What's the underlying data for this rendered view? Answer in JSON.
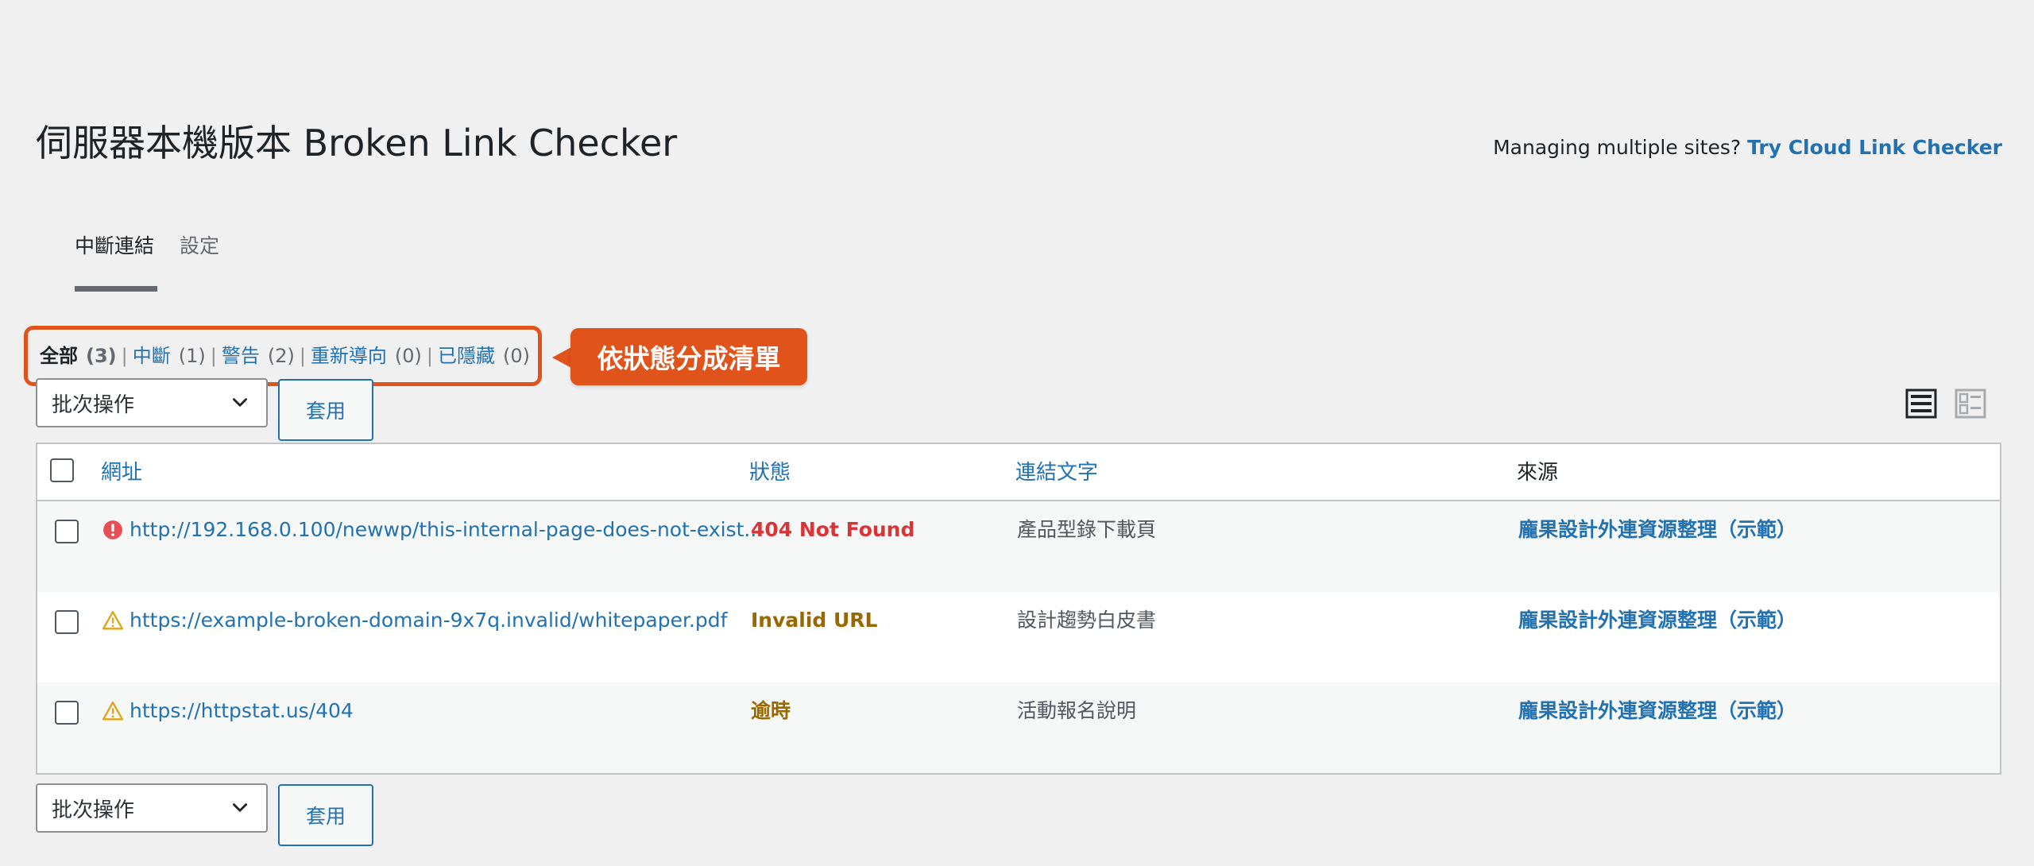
{
  "page": {
    "title": "伺服器本機版本 Broken Link Checker",
    "cloud_question": "Managing multiple sites?",
    "cloud_link": "Try Cloud Link Checker"
  },
  "tabs": {
    "broken_links": "中斷連結",
    "settings": "設定"
  },
  "filters": {
    "all": {
      "label": "全部",
      "count": "(3)"
    },
    "broken": {
      "label": "中斷",
      "count": "(1)"
    },
    "warning": {
      "label": "警告",
      "count": "(2)"
    },
    "redirect": {
      "label": "重新導向",
      "count": "(0)"
    },
    "dismissed": {
      "label": "已隱藏",
      "count": "(0)"
    },
    "separator": "|"
  },
  "callout": {
    "text": "依狀態分成清單"
  },
  "bulk": {
    "select_label": "批次操作",
    "apply_label": "套用"
  },
  "table": {
    "headers": {
      "url": "網址",
      "status": "狀態",
      "link_text": "連結文字",
      "source": "來源"
    },
    "rows": [
      {
        "url": "http://192.168.0.100/newwp/this-internal-page-does-not-exist...",
        "status": "404 Not Found",
        "link_text": "產品型錄下載頁",
        "source": "龐果設計外連資源整理（示範）",
        "icon": "error-icon"
      },
      {
        "url": "https://example-broken-domain-9x7q.invalid/whitepaper.pdf",
        "status": "Invalid URL",
        "link_text": "設計趨勢白皮書",
        "source": "龐果設計外連資源整理（示範）",
        "icon": "warning-icon"
      },
      {
        "url": "https://httpstat.us/404",
        "status": "逾時",
        "link_text": "活動報名說明",
        "source": "龐果設計外連資源整理（示範）",
        "icon": "warning-icon"
      }
    ]
  },
  "colors": {
    "accent": "#2271b1",
    "callout": "#e0531b",
    "status_error": "#d63638",
    "status_warning": "#996800",
    "icon_error": "#e65054",
    "icon_warning": "#dba617"
  },
  "icons": {
    "view_list": "list-view-icon",
    "view_excerpt": "excerpt-view-icon",
    "dropdown": "chevron-down-icon"
  }
}
